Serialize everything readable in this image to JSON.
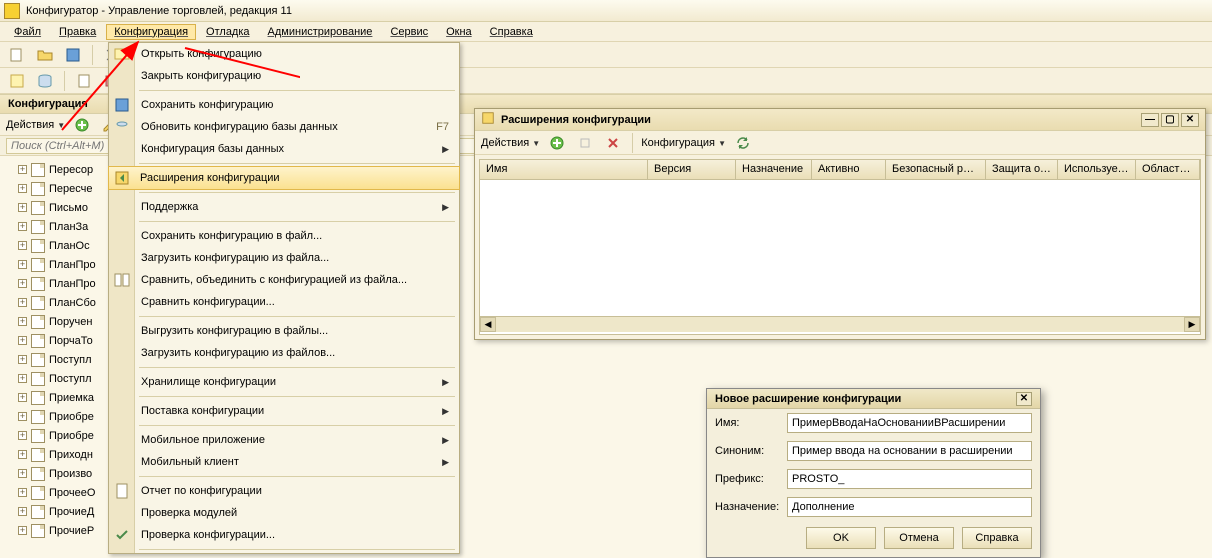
{
  "app": {
    "title": "Конфигуратор - Управление торговлей, редакция 11"
  },
  "menu": {
    "file": "Файл",
    "edit": "Правка",
    "config": "Конфигурация",
    "debug": "Отладка",
    "admin": "Администрирование",
    "service": "Сервис",
    "windows": "Окна",
    "help": "Справка"
  },
  "dropdown": {
    "open": "Открыть конфигурацию",
    "close": "Закрыть конфигурацию",
    "save": "Сохранить конфигурацию",
    "updateDb": "Обновить конфигурацию базы данных",
    "updateDbKey": "F7",
    "dbConfig": "Конфигурация базы данных",
    "ext": "Расширения конфигурации",
    "support": "Поддержка",
    "saveFile": "Сохранить конфигурацию в файл...",
    "loadFile": "Загрузить конфигурацию из файла...",
    "compareFile": "Сравнить, объединить с конфигурацией из файла...",
    "compare": "Сравнить конфигурации...",
    "exportFiles": "Выгрузить конфигурацию в файлы...",
    "importFiles": "Загрузить конфигурацию из файлов...",
    "repo": "Хранилище конфигурации",
    "delivery": "Поставка конфигурации",
    "mobileApp": "Мобильное приложение",
    "mobileClient": "Мобильный клиент",
    "report": "Отчет по конфигурации",
    "checkModules": "Проверка модулей",
    "checkConfig": "Проверка конфигурации..."
  },
  "sidebar": {
    "title": "Конфигурация",
    "actions": "Действия",
    "searchPlaceholder": "Поиск (Ctrl+Alt+M)",
    "items": [
      "Пересор",
      "Пересче",
      "Письмо",
      "ПланЗа",
      "ПланОс",
      "ПланПро",
      "ПланПро",
      "ПланСбо",
      "Поручен",
      "ПорчаТо",
      "Поступл",
      "Поступл",
      "Приемка",
      "Приобре",
      "Приобре",
      "Приходн",
      "Произво",
      "ПрочееО",
      "ПрочиеД",
      "ПрочиеР"
    ]
  },
  "extWin": {
    "title": "Расширения конфигурации",
    "actions": "Действия",
    "config": "Конфигурация",
    "cols": {
      "name": "Имя",
      "ver": "Версия",
      "purpose": "Назначение",
      "active": "Активно",
      "safe": "Безопасный реж...",
      "protect": "Защита от ...",
      "used": "Использует...",
      "scope": "Область ..."
    }
  },
  "dlg": {
    "title": "Новое расширение конфигурации",
    "name": "Имя:",
    "nameVal": "ПримерВводаНаОснованииВРасширении",
    "syn": "Синоним:",
    "synVal": "Пример ввода на основании в расширении",
    "prefix": "Префикс:",
    "prefixVal": "PROSTO_",
    "purpose": "Назначение:",
    "purposeVal": "Дополнение",
    "ok": "OK",
    "cancel": "Отмена",
    "help": "Справка"
  }
}
